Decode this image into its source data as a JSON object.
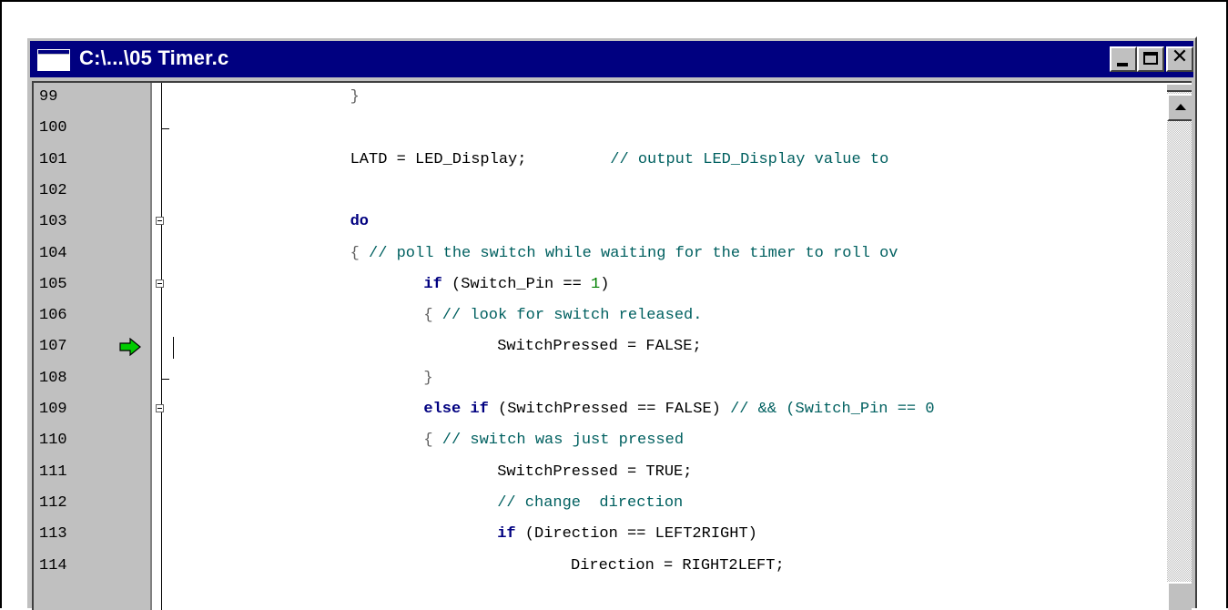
{
  "window": {
    "title": "C:\\...\\05 Timer.c",
    "buttons": {
      "minimize": "minimize-icon",
      "maximize": "maximize-icon",
      "close": "close-icon",
      "close_glyph": "✕"
    }
  },
  "editor": {
    "current_line": "107",
    "lines": [
      {
        "num": "99",
        "fold": "",
        "tick": false,
        "code": [
          [
            "p",
            "}"
          ]
        ],
        "indent": 16
      },
      {
        "num": "100",
        "fold": "",
        "tick": true,
        "code": [],
        "indent": 0
      },
      {
        "num": "101",
        "fold": "",
        "tick": false,
        "code": [
          [
            "t",
            "LATD = LED_Display;         "
          ],
          [
            "c",
            "// output LED_Display value to"
          ]
        ],
        "indent": 16
      },
      {
        "num": "102",
        "fold": "",
        "tick": false,
        "code": [],
        "indent": 0
      },
      {
        "num": "103",
        "fold": "box",
        "tick": false,
        "code": [
          [
            "k",
            "do"
          ]
        ],
        "indent": 16
      },
      {
        "num": "104",
        "fold": "",
        "tick": false,
        "code": [
          [
            "p",
            "{ "
          ],
          [
            "c",
            "// poll the switch while waiting for the timer to roll ov"
          ]
        ],
        "indent": 16
      },
      {
        "num": "105",
        "fold": "box",
        "tick": false,
        "code": [
          [
            "k",
            "if"
          ],
          [
            "t",
            " (Switch_Pin == "
          ],
          [
            "n",
            "1"
          ],
          [
            "t",
            ")"
          ]
        ],
        "indent": 24
      },
      {
        "num": "106",
        "fold": "",
        "tick": false,
        "code": [
          [
            "p",
            "{ "
          ],
          [
            "c",
            "// look for switch released."
          ]
        ],
        "indent": 24
      },
      {
        "num": "107",
        "fold": "",
        "tick": false,
        "code": [
          [
            "t",
            "SwitchPressed = "
          ],
          [
            "t",
            "FALSE"
          ],
          [
            "t",
            ";"
          ]
        ],
        "indent": 32
      },
      {
        "num": "108",
        "fold": "",
        "tick": true,
        "code": [
          [
            "p",
            "}"
          ]
        ],
        "indent": 24
      },
      {
        "num": "109",
        "fold": "box",
        "tick": false,
        "code": [
          [
            "k",
            "else if"
          ],
          [
            "t",
            " (SwitchPressed == "
          ],
          [
            "t",
            "FALSE"
          ],
          [
            "t",
            ") "
          ],
          [
            "c",
            "// && (Switch_Pin == 0"
          ]
        ],
        "indent": 24
      },
      {
        "num": "110",
        "fold": "",
        "tick": false,
        "code": [
          [
            "p",
            "{ "
          ],
          [
            "c",
            "// switch was just pressed"
          ]
        ],
        "indent": 24
      },
      {
        "num": "111",
        "fold": "",
        "tick": false,
        "code": [
          [
            "t",
            "SwitchPressed = "
          ],
          [
            "t",
            "TRUE"
          ],
          [
            "t",
            ";"
          ]
        ],
        "indent": 32
      },
      {
        "num": "112",
        "fold": "",
        "tick": false,
        "code": [
          [
            "c",
            "// change  direction"
          ]
        ],
        "indent": 32
      },
      {
        "num": "113",
        "fold": "",
        "tick": false,
        "code": [
          [
            "k",
            "if"
          ],
          [
            "t",
            " (Direction == "
          ],
          [
            "t",
            "LEFT2RIGHT"
          ],
          [
            "t",
            ")"
          ]
        ],
        "indent": 32
      },
      {
        "num": "114",
        "fold": "",
        "tick": false,
        "code": [
          [
            "t",
            "Direction = "
          ],
          [
            "t",
            "RIGHT2LEFT"
          ],
          [
            "t",
            ";"
          ]
        ],
        "indent": 40
      }
    ]
  },
  "icons": {
    "execution_arrow": "green-arrow-icon",
    "scroll_up": "scroll-up-arrow-icon"
  },
  "colors": {
    "title_bar": "#000080",
    "keyword": "#000080",
    "comment": "#006060",
    "number": "#008000",
    "arrow": "#00cc00"
  }
}
